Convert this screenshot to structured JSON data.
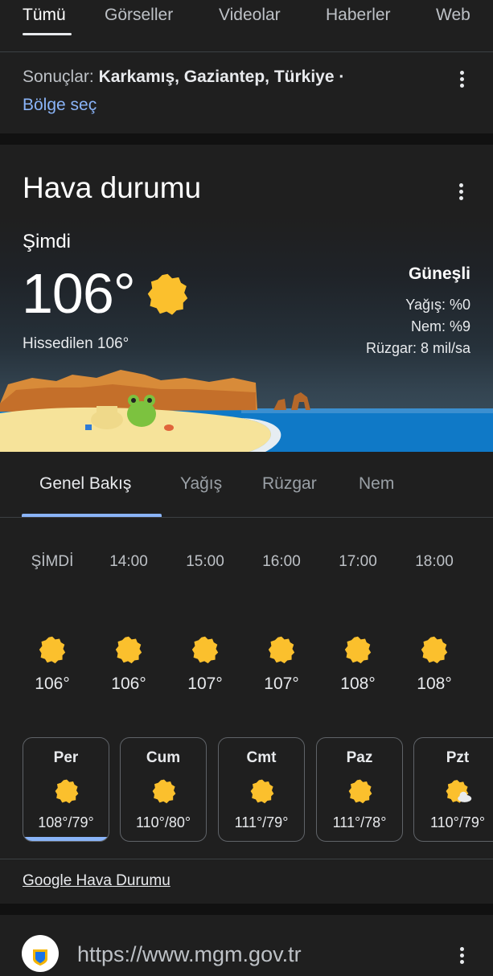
{
  "top_tabs": [
    "Tümü",
    "Görseller",
    "Videolar",
    "Haberler",
    "Web"
  ],
  "location": {
    "prefix": "Sonuçlar: ",
    "place": "Karkamış, Gaziantep, Türkiye ·",
    "region_link": "Bölge seç"
  },
  "weather": {
    "title": "Hava durumu",
    "now_label": "Şimdi",
    "temp": "106°",
    "feels_like": "Hissedilen 106°",
    "condition": "Güneşli",
    "precip": "Yağış: %0",
    "humidity": "Nem: %9",
    "wind": "Rüzgar: 8 mil/sa",
    "icon": "sun-icon"
  },
  "sub_tabs": [
    "Genel Bakış",
    "Yağış",
    "Rüzgar",
    "Nem"
  ],
  "hourly": [
    {
      "time": "ŞİMDİ",
      "temp": "106°",
      "icon": "sun-icon"
    },
    {
      "time": "14:00",
      "temp": "106°",
      "icon": "sun-icon"
    },
    {
      "time": "15:00",
      "temp": "107°",
      "icon": "sun-icon"
    },
    {
      "time": "16:00",
      "temp": "107°",
      "icon": "sun-icon"
    },
    {
      "time": "17:00",
      "temp": "108°",
      "icon": "sun-icon"
    },
    {
      "time": "18:00",
      "temp": "108°",
      "icon": "sun-icon"
    }
  ],
  "daily": [
    {
      "day": "Per",
      "temps": "108°/79°",
      "icon": "sun-icon"
    },
    {
      "day": "Cum",
      "temps": "110°/80°",
      "icon": "sun-icon"
    },
    {
      "day": "Cmt",
      "temps": "111°/79°",
      "icon": "sun-icon"
    },
    {
      "day": "Paz",
      "temps": "111°/78°",
      "icon": "sun-icon"
    },
    {
      "day": "Pzt",
      "temps": "110°/79°",
      "icon": "partly-sunny-icon"
    }
  ],
  "footer_link": "Google Hava Durumu",
  "next_result": {
    "url": "https://www.mgm.gov.tr"
  },
  "colors": {
    "accent": "#8ab4f8",
    "sun": "#fbc02d",
    "background": "#1f1f1f"
  }
}
